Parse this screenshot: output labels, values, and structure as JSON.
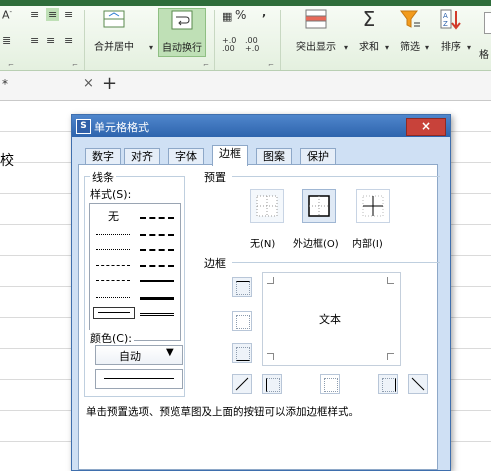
{
  "ribbon": {
    "merge_label": "合并居中",
    "wrap_label": "自动换行",
    "percent_symbol": "%",
    "decimal_inc": "+.0 .00",
    "decimal_dec": ".00 +.0",
    "highlight_label": "突出显示",
    "sum_label": "求和",
    "filter_label": "筛选",
    "sort_label": "排序",
    "format_label": "格"
  },
  "tabs_bar": {
    "asterisk": "*",
    "close": "×",
    "plus": "+"
  },
  "sheet": {
    "cell_text": "校"
  },
  "dialog": {
    "title": "单元格格式",
    "close": "×",
    "tabs": [
      "数字",
      "对齐",
      "字体",
      "边框",
      "图案",
      "保护"
    ],
    "active_tab": "边框",
    "line_group": "线条",
    "style_label": "样式(S):",
    "none_label": "无",
    "color_label": "颜色(C):",
    "color_value": "自动",
    "preset_group": "预置",
    "presets": [
      "无(N)",
      "外边框(O)",
      "内部(I)"
    ],
    "border_group": "边框",
    "preview_text": "文本",
    "hint": "单击预置选项、预览草图及上面的按钮可以添加边框样式。"
  },
  "colors": {
    "title_bar": "#2e64ad",
    "close_button": "#c8423a",
    "ribbon_bg": "#e4f0df"
  }
}
